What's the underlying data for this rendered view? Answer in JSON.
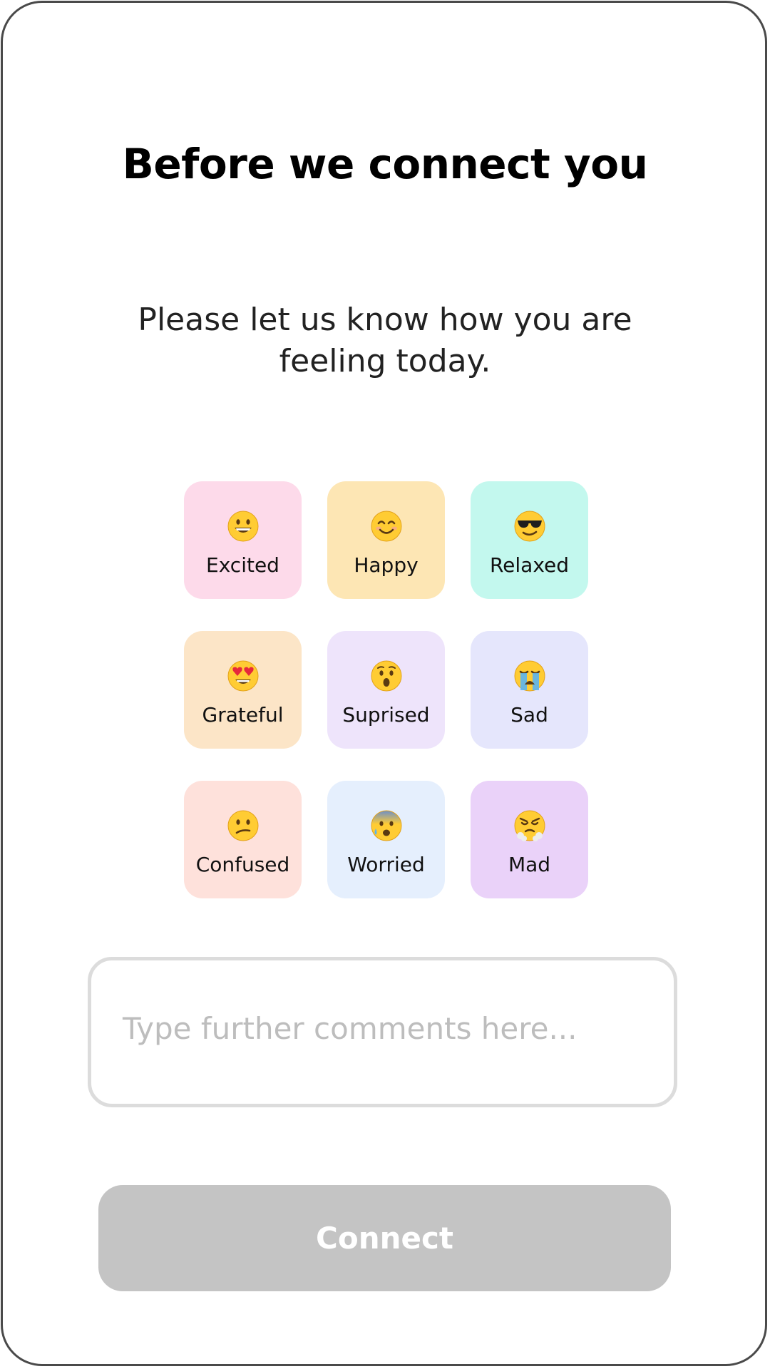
{
  "header": {
    "title": "Before we connect you",
    "subtitle": "Please let us know how you are feeling today."
  },
  "moods": [
    {
      "label": "Excited",
      "icon": "grinning-face-icon",
      "color": "#FDDAEA"
    },
    {
      "label": "Happy",
      "icon": "smiling-face-icon",
      "color": "#FDE6B4"
    },
    {
      "label": "Relaxed",
      "icon": "sunglasses-face-icon",
      "color": "#C3F8EE"
    },
    {
      "label": "Grateful",
      "icon": "heart-eyes-face-icon",
      "color": "#FCE5C7"
    },
    {
      "label": "Suprised",
      "icon": "astonished-face-icon",
      "color": "#EEE4FB"
    },
    {
      "label": "Sad",
      "icon": "crying-face-icon",
      "color": "#E5E6FC"
    },
    {
      "label": "Confused",
      "icon": "confused-face-icon",
      "color": "#FEE1DB"
    },
    {
      "label": "Worried",
      "icon": "anxious-sweat-face-icon",
      "color": "#E5EFFD"
    },
    {
      "label": "Mad",
      "icon": "steam-nose-face-icon",
      "color": "#EAD2F9"
    }
  ],
  "comments": {
    "placeholder": "Type further comments here..."
  },
  "actions": {
    "connect_label": "Connect",
    "connect_color": "#C4C4C4"
  }
}
